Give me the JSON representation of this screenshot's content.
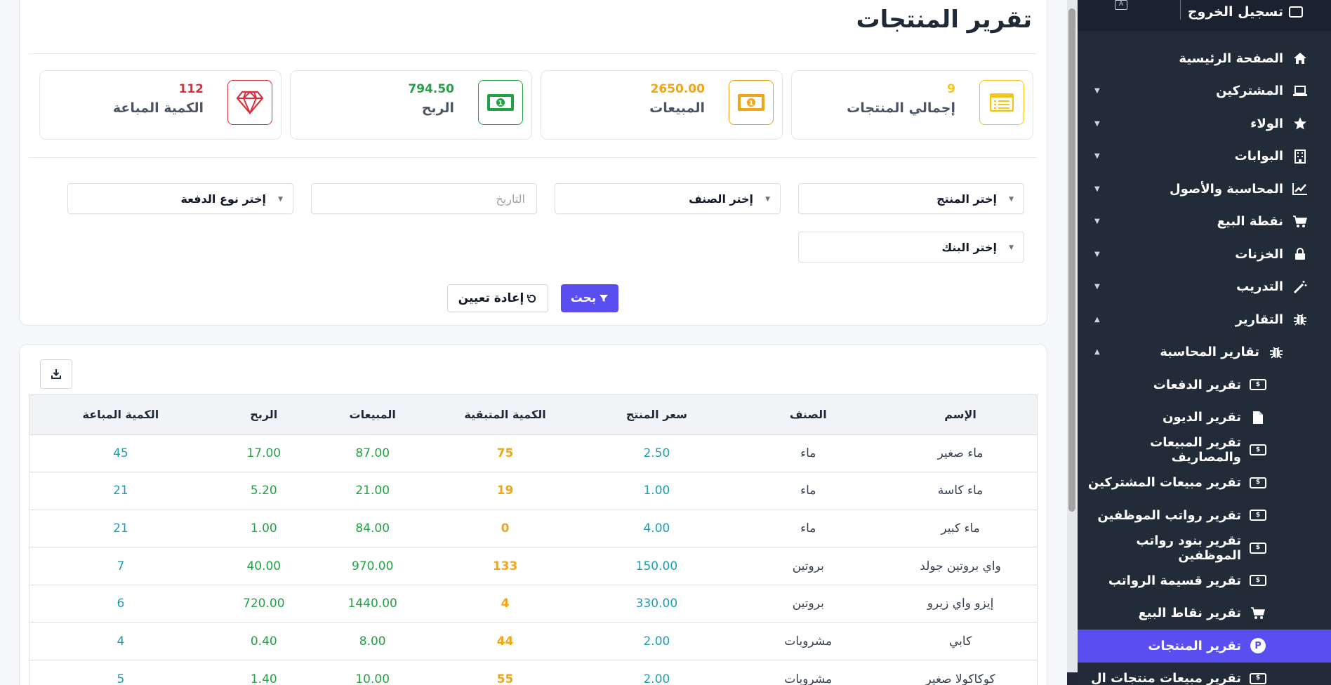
{
  "sidebar": {
    "logout_label": "تسجيل الخروج",
    "items": [
      {
        "label": "الصفحة الرئيسية",
        "icon": "home-icon",
        "level": 0
      },
      {
        "label": "المشتركين",
        "icon": "laptop-icon",
        "level": 0,
        "caret": "▼"
      },
      {
        "label": "الولاء",
        "icon": "star-icon",
        "level": 0,
        "caret": "▼"
      },
      {
        "label": "البوابات",
        "icon": "building-icon",
        "level": 0,
        "caret": "▼"
      },
      {
        "label": "المحاسبة والأصول",
        "icon": "chart-line-icon",
        "level": 0,
        "caret": "▼"
      },
      {
        "label": "نقطة البيع",
        "icon": "cart-icon",
        "level": 0,
        "caret": "▼"
      },
      {
        "label": "الخزنات",
        "icon": "lock-icon",
        "level": 0,
        "caret": "▼"
      },
      {
        "label": "التدريب",
        "icon": "magic-wand-icon",
        "level": 0,
        "caret": "▼"
      },
      {
        "label": "التقارير",
        "icon": "bug-icon",
        "level": 0,
        "caret": "▲"
      },
      {
        "label": "تقارير المحاسبة",
        "icon": "bug-icon",
        "level": 1,
        "caret": "▲"
      },
      {
        "label": "تقرير الدفعات",
        "icon": "money-bill-icon",
        "level": 2
      },
      {
        "label": "تقرير الديون",
        "icon": "file-icon",
        "level": 2
      },
      {
        "label": "تقرير المبيعات والمصاريف",
        "icon": "money-bill-icon",
        "level": 2
      },
      {
        "label": "تقرير مبيعات المشتركين",
        "icon": "money-bill-icon",
        "level": 2
      },
      {
        "label": "تقرير رواتب الموظفين",
        "icon": "money-bill-icon",
        "level": 2
      },
      {
        "label": "تقرير بنود رواتب الموظفين",
        "icon": "money-bill-icon",
        "level": 2
      },
      {
        "label": "تقرير قسيمة الرواتب",
        "icon": "money-bill-icon",
        "level": 2
      },
      {
        "label": "تقرير نقاط البيع",
        "icon": "cart-icon",
        "level": 2
      },
      {
        "label": "تقرير المنتجات",
        "icon": "product-p-icon",
        "level": 2,
        "active": true
      },
      {
        "label": "تقرير مبيعات منتجات ال",
        "icon": "money-bill-icon",
        "level": 2
      }
    ]
  },
  "page": {
    "title": "تقرير المنتجات"
  },
  "stats": [
    {
      "value": "9",
      "label": "إجمالي المنتجات",
      "color": "#f5c518",
      "icon": "list-icon"
    },
    {
      "value": "2650.00",
      "label": "المبيعات",
      "color": "#f2a516",
      "icon": "money-bill-icon"
    },
    {
      "value": "794.50",
      "label": "الربح",
      "color": "#22a244",
      "icon": "money-bill-icon"
    },
    {
      "value": "112",
      "label": "الكمية المباعة",
      "color": "#dc2f3c",
      "icon": "diamond-icon"
    }
  ],
  "filters": {
    "product": "إختر المنتج",
    "category": "إختر الصنف",
    "date_placeholder": "التاريخ",
    "payment_type": "إختر نوع الدفعة",
    "bank": "إختر البنك"
  },
  "buttons": {
    "search": "بحث",
    "reset": "إعادة تعيين"
  },
  "table": {
    "headers": [
      "الإسم",
      "الصنف",
      "سعر المنتج",
      "الكمية المتبقية",
      "المبيعات",
      "الربح",
      "الكمية المباعة"
    ],
    "rows": [
      [
        "ماء صغير",
        "ماء",
        "2.50",
        "75",
        "87.00",
        "17.00",
        "45"
      ],
      [
        "ماء كاسة",
        "ماء",
        "1.00",
        "19",
        "21.00",
        "5.20",
        "21"
      ],
      [
        "ماء كبير",
        "ماء",
        "4.00",
        "0",
        "84.00",
        "1.00",
        "21"
      ],
      [
        "واي بروتين جولد",
        "بروتين",
        "150.00",
        "133",
        "970.00",
        "40.00",
        "7"
      ],
      [
        "إيزو واي زيرو",
        "بروتين",
        "330.00",
        "4",
        "1440.00",
        "720.00",
        "6"
      ],
      [
        "كابي",
        "مشروبات",
        "2.00",
        "44",
        "8.00",
        "0.40",
        "4"
      ],
      [
        "كوكاكولا صغير",
        "مشروبات",
        "2.00",
        "55",
        "10.00",
        "1.40",
        "5"
      ]
    ]
  }
}
